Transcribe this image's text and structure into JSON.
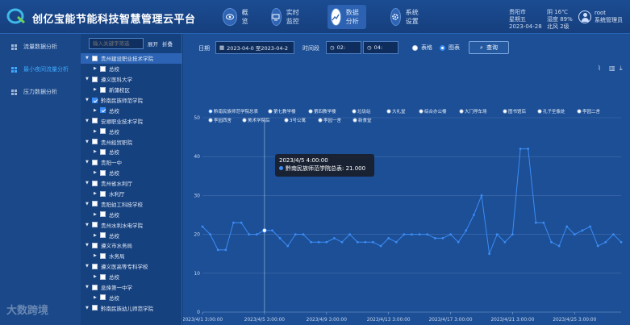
{
  "header": {
    "title": "创亿宝能节能科技智慧管理云平台",
    "nav": [
      {
        "label": "概览",
        "icon": "eye-icon",
        "active": false
      },
      {
        "label": "实时监控",
        "icon": "monitor-icon",
        "active": false
      },
      {
        "label": "数据分析",
        "icon": "analysis-icon",
        "active": true
      },
      {
        "label": "系统设置",
        "icon": "settings-icon",
        "active": false
      }
    ],
    "city": "贵阳市",
    "weather": "阴 16℃",
    "weekday": "星期五",
    "humidity": "湿度 89%",
    "date": "2023-04-28",
    "wind": "北风 2级",
    "user_name": "root",
    "user_role": "系统管理员"
  },
  "left_menu": [
    {
      "label": "流量数据分析",
      "active": false
    },
    {
      "label": "最小夜间流量分析",
      "active": true
    },
    {
      "label": "压力数据分析",
      "active": false
    }
  ],
  "tree": {
    "search_placeholder": "输入关键字筛选",
    "expand_label": "展开",
    "collapse_label": "折叠",
    "nodes": [
      {
        "label": "贵州建设职业技术学院",
        "level": 1,
        "checked": false,
        "selected": true
      },
      {
        "label": "总校",
        "level": 2,
        "checked": false
      },
      {
        "label": "遵义医科大学",
        "level": 1,
        "checked": false
      },
      {
        "label": "新蒲校区",
        "level": 2,
        "checked": false
      },
      {
        "label": "黔南民族师范学院",
        "level": 1,
        "checked": true
      },
      {
        "label": "总校",
        "level": 2,
        "checked": true
      },
      {
        "label": "安顺职业技术学院",
        "level": 1,
        "checked": false
      },
      {
        "label": "总校",
        "level": 2,
        "checked": false
      },
      {
        "label": "贵州经贸职院",
        "level": 1,
        "checked": false
      },
      {
        "label": "总校",
        "level": 2,
        "checked": false
      },
      {
        "label": "贵阳一中",
        "level": 1,
        "checked": false
      },
      {
        "label": "总校",
        "level": 2,
        "checked": false
      },
      {
        "label": "贵州省水利厅",
        "level": 1,
        "checked": false
      },
      {
        "label": "水利厅",
        "level": 2,
        "checked": false
      },
      {
        "label": "贵阳幼工科技学校",
        "level": 1,
        "checked": false
      },
      {
        "label": "总校",
        "level": 2,
        "checked": false
      },
      {
        "label": "贵州水利水电学院",
        "level": 1,
        "checked": false
      },
      {
        "label": "总校",
        "level": 2,
        "checked": false
      },
      {
        "label": "遵义市水务局",
        "level": 1,
        "checked": false
      },
      {
        "label": "水务局",
        "level": 2,
        "checked": false
      },
      {
        "label": "遵义医高等专科学校",
        "level": 1,
        "checked": false
      },
      {
        "label": "总校",
        "level": 2,
        "checked": false
      },
      {
        "label": "息烽第一中学",
        "level": 1,
        "checked": false
      },
      {
        "label": "总校",
        "level": 2,
        "checked": false
      },
      {
        "label": "黔南民族幼儿师范学院",
        "level": 1,
        "checked": false
      }
    ]
  },
  "filter": {
    "date_label": "日期",
    "date_value": "2023-04-0 至2023-04-2",
    "period_label": "时间段",
    "time_start": "02:",
    "time_end": "04:",
    "view_table": "表格",
    "view_chart": "图表",
    "query_label": "查询"
  },
  "chart_data": {
    "type": "line",
    "legend": [
      "黔南民族师范学院总表",
      "第七教学楼",
      "第四教学楼",
      "垃圾站",
      "大礼堂",
      "综合办公楼",
      "大门停车场",
      "图书馆后",
      "孔子圣像处",
      "李园二舍",
      "李园西舍",
      "美术学院后",
      "3号公寓",
      "李园一舍",
      "新食堂"
    ],
    "x_tick_labels": [
      "2023/4/1 3:00:00",
      "2023/4/5 3:00:00",
      "2023/4/9 3:00:00",
      "2023/4/13 3:00:00",
      "2023/4/17 3:00:00",
      "2023/4/21 3:00:00",
      "2023/4/25 3:00:00"
    ],
    "ylim": [
      0,
      50
    ],
    "y_ticks": [
      0,
      10,
      20,
      30,
      40,
      50
    ],
    "series": [
      {
        "name": "黔南民族师范学院总表",
        "values": [
          22,
          20,
          16,
          16,
          23,
          23,
          20,
          20,
          21,
          21,
          19,
          17,
          20,
          20,
          18,
          18,
          18,
          19,
          18,
          20,
          18,
          18,
          18,
          17,
          19,
          18,
          20,
          20,
          20,
          20,
          19,
          19,
          20,
          18,
          21,
          25,
          30,
          15,
          20,
          18,
          20,
          42,
          42,
          23,
          23,
          18,
          17,
          22,
          20,
          21,
          22,
          17,
          18,
          20,
          18
        ]
      }
    ],
    "tooltip": {
      "title": "2023/4/5 4:00:00",
      "series": "黔南民族师范学院总表",
      "value": "21.000"
    }
  },
  "watermark": "大数跨境",
  "colors": {
    "line": "#3c8cf5",
    "accent": "#3fa9ff"
  }
}
